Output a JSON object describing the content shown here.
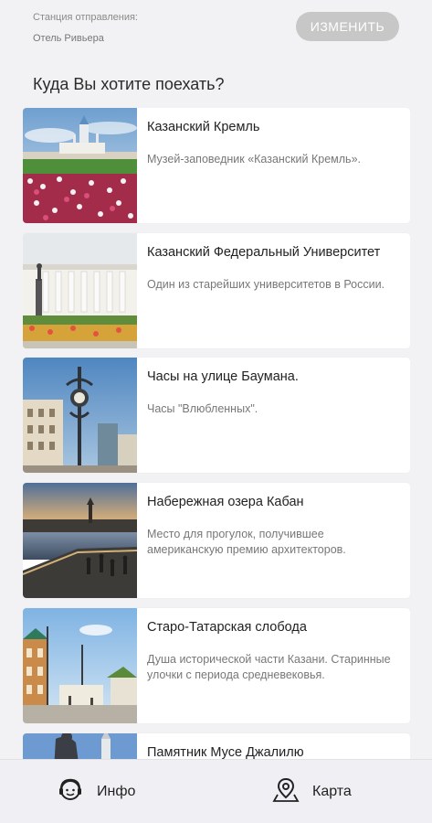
{
  "header": {
    "departure_label": "Станция отправления:",
    "departure_value": "Отель Ривьера",
    "change_button": "ИЗМЕНИТЬ"
  },
  "question": "Куда Вы хотите поехать?",
  "places": [
    {
      "title": "Казанский Кремль",
      "description": "Музей-заповедник «Казанский Кремль»."
    },
    {
      "title": "Казанский Федеральный Университет",
      "description": "Один из старейших университетов в России."
    },
    {
      "title": "Часы на улице Баумана.",
      "description": "Часы \"Влюбленных\"."
    },
    {
      "title": "Набережная озера Кабан",
      "description": "Место для прогулок, получившее американскую премию архитекторов."
    },
    {
      "title": "Старо-Татарская слобода",
      "description": "Душа исторической части Казани. Старинные улочки с периода средневековья."
    },
    {
      "title": "Памятник Мусе Джалилю",
      "description": ""
    }
  ],
  "nav": {
    "info_label": "Инфо",
    "map_label": "Карта",
    "info_icon": "headset-avatar-icon",
    "map_icon": "map-pin-icon"
  }
}
